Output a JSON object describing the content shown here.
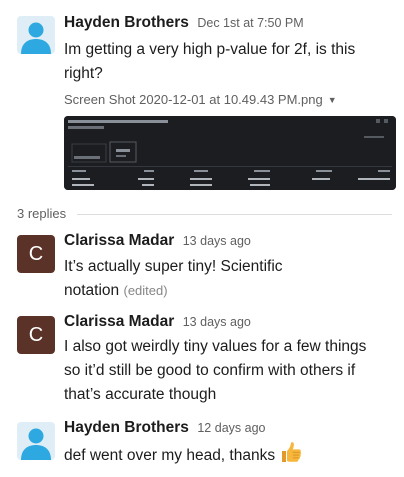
{
  "messages": [
    {
      "sender": "Hayden Brothers",
      "time": "Dec 1st at 7:50 PM",
      "text_line1": "Im getting a very high p-value for 2f, is this",
      "text_line2": "right?",
      "attachment": {
        "filename": "Screen Shot 2020-12-01 at 10.49.43 PM.png",
        "caret": "▼"
      }
    }
  ],
  "replies_count": "3 replies",
  "replies": [
    {
      "sender": "Clarissa Madar",
      "initial": "C",
      "time": "13 days ago",
      "text_line1": "It’s actually super tiny! Scientific",
      "text_line2": "notation",
      "edited": "(edited)"
    },
    {
      "sender": "Clarissa Madar",
      "initial": "C",
      "time": "13 days ago",
      "text_line1": "I also got weirdly tiny values for a few things",
      "text_line2": "so it’d still be good to confirm with others if",
      "text_line3": "that’s accurate though"
    },
    {
      "sender": "Hayden Brothers",
      "time": "12 days ago",
      "text": "def went over my head, thanks",
      "emoji": "thumbs-up-icon"
    }
  ],
  "colors": {
    "letter_avatar_bg": "#5a3227",
    "default_avatar_bg": "#dfeef6",
    "default_avatar_fg": "#2ea8e0",
    "thumbs_up": "#f6b73c"
  }
}
